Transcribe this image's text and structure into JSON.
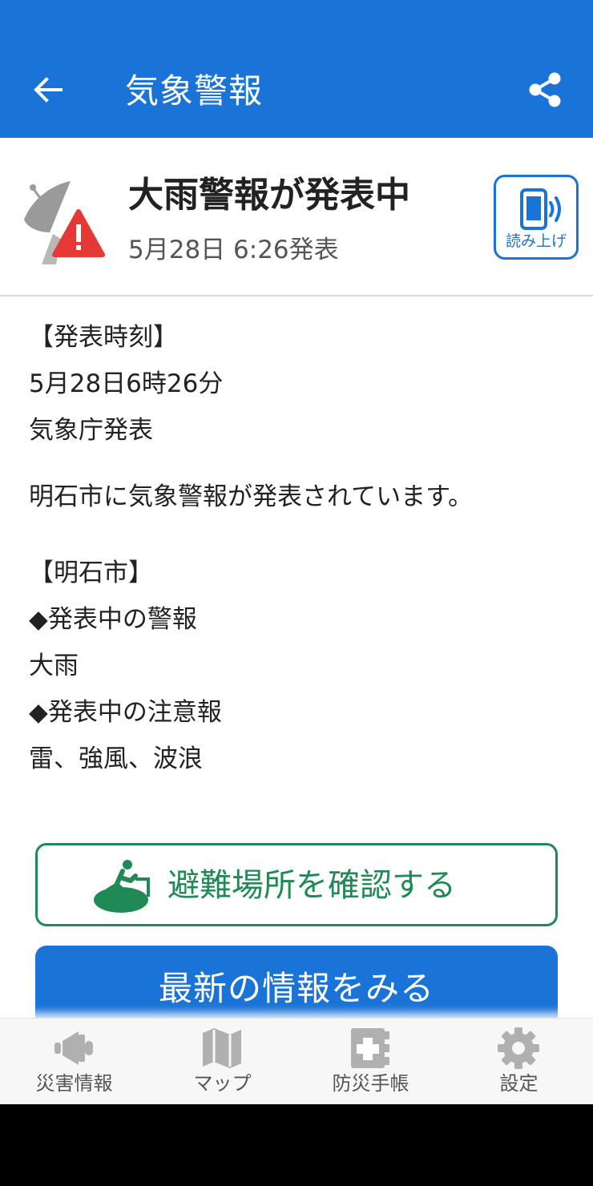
{
  "appbar": {
    "title": "気象警報",
    "back_icon": "arrow-left-icon",
    "share_icon": "share-icon"
  },
  "alert": {
    "title": "大雨警報が発表中",
    "issued": "5月28日 6:26発表",
    "icon": "satellite-warning-icon",
    "readaloud_label": "読み上げ",
    "colors": {
      "warning": "#e53935",
      "accent": "#1a73d6"
    }
  },
  "body": {
    "lines": [
      "【発表時刻】",
      "5月28日6時26分",
      "気象庁発表",
      "明石市に気象警報が発表されています。",
      "【明石市】",
      "◆発表中の警報",
      "大雨",
      "◆発表中の注意報",
      "雷、強風、波浪"
    ]
  },
  "evac_button": {
    "label": "避難場所を確認する",
    "icon": "evacuation-exit-icon",
    "color": "#1f8a55"
  },
  "latest_button": {
    "label": "最新の情報をみる"
  },
  "bottom_nav": {
    "items": [
      {
        "label": "災害情報",
        "icon": "megaphone-icon"
      },
      {
        "label": "マップ",
        "icon": "map-icon"
      },
      {
        "label": "防災手帳",
        "icon": "first-aid-book-icon"
      },
      {
        "label": "設定",
        "icon": "gear-icon"
      }
    ]
  }
}
